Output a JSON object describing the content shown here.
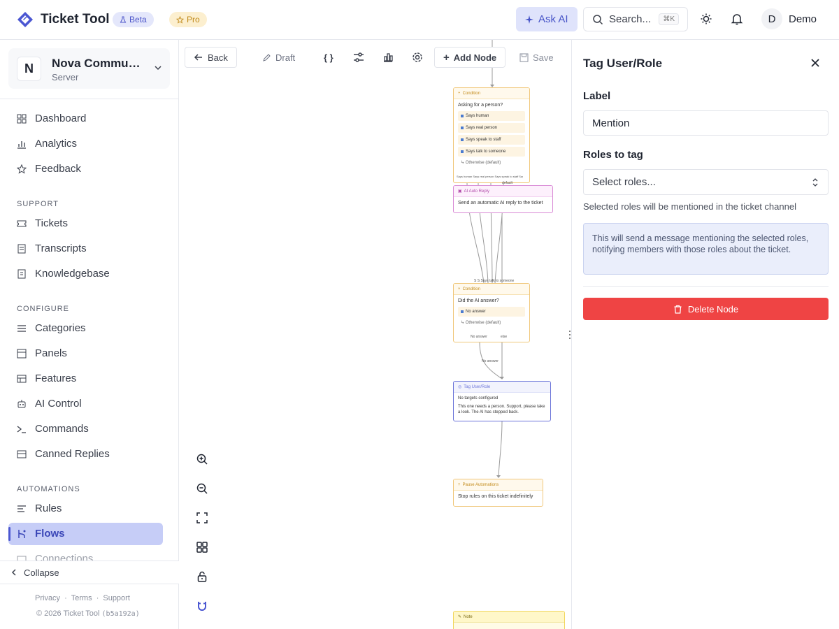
{
  "app": {
    "title": "Ticket Tool",
    "beta_badge": "Beta",
    "pro_badge": "Pro",
    "ask_ai_label": "Ask AI",
    "search_placeholder": "Search...",
    "search_shortcut": "⌘K",
    "user_initial": "D",
    "user_name": "Demo"
  },
  "sidebar": {
    "server_initial": "N",
    "server_name": "Nova Community",
    "server_type": "Server",
    "top_items": [
      {
        "label": "Dashboard",
        "icon": "grid-icon"
      },
      {
        "label": "Analytics",
        "icon": "chart-icon"
      },
      {
        "label": "Feedback",
        "icon": "star-icon"
      }
    ],
    "section_support": "SUPPORT",
    "support_items": [
      {
        "label": "Tickets",
        "icon": "ticket-icon"
      },
      {
        "label": "Transcripts",
        "icon": "document-icon"
      },
      {
        "label": "Knowledgebase",
        "icon": "book-icon"
      }
    ],
    "section_configure": "CONFIGURE",
    "configure_items": [
      {
        "label": "Categories",
        "icon": "list-icon"
      },
      {
        "label": "Panels",
        "icon": "panel-icon"
      },
      {
        "label": "Features",
        "icon": "features-icon"
      },
      {
        "label": "AI Control",
        "icon": "robot-icon"
      },
      {
        "label": "Commands",
        "icon": "terminal-icon"
      },
      {
        "label": "Canned Replies",
        "icon": "reply-icon"
      }
    ],
    "section_automations": "AUTOMATIONS",
    "automation_items": [
      {
        "label": "Rules",
        "icon": "rules-icon"
      },
      {
        "label": "Flows",
        "icon": "flow-icon",
        "active": true
      },
      {
        "label": "Connections",
        "icon": "connection-icon"
      }
    ],
    "collapse_label": "Collapse",
    "footer_links": [
      "Privacy",
      "Terms",
      "Support"
    ],
    "copyright": "© 2026 Ticket Tool",
    "build_hash": "(b5a192a)"
  },
  "canvas": {
    "back_label": "Back",
    "draft_label": "Draft",
    "code_label": "{ }",
    "add_node_label": "Add Node",
    "save_label": "Save",
    "nodes": {
      "condition1": {
        "type": "Condition",
        "question": "Asking for a person?",
        "rows": [
          "Says human",
          "Says real person",
          "Says speak to staff",
          "Says talk to someone"
        ],
        "default": "↳ Otherwise (default)",
        "outputs": "Says human  Says real person  Says speak to staff  Says talk to someone",
        "default_output": "default"
      },
      "ai_reply": {
        "type": "AI Auto Reply",
        "body": "Send an automatic AI reply to the ticket"
      },
      "condition2": {
        "type": "Condition",
        "question": "Did the AI answer?",
        "rows": [
          "No answer"
        ],
        "default": "↳ Otherwise (default)",
        "out_no": "No answer",
        "out_else": "else",
        "incoming_label": "S S Says talk to someone",
        "edge_label": "No answer"
      },
      "tag": {
        "type": "Tag User/Role",
        "line1": "No targets configured",
        "line2": "This one needs a person. Support, please take a look. The AI has stepped back."
      },
      "pause": {
        "type": "Pause Automations",
        "body": "Stop rules on this ticket indefinitely"
      },
      "note": {
        "type": "Note"
      }
    }
  },
  "panel": {
    "title": "Tag User/Role",
    "label_field": "Label",
    "label_value": "Mention",
    "roles_field": "Roles to tag",
    "roles_placeholder": "Select roles...",
    "roles_help": "Selected roles will be mentioned in the ticket channel",
    "info": "This will send a message mentioning the selected roles, notifying members with those roles about the ticket.",
    "delete_label": "Delete Node"
  },
  "colors": {
    "accent": "#4b57d2",
    "active_bg": "#c6cdf7",
    "danger": "#ef4444",
    "condition": "#f0c77a",
    "ai_node": "#d98ad6",
    "tag_node": "#6b74d9"
  }
}
